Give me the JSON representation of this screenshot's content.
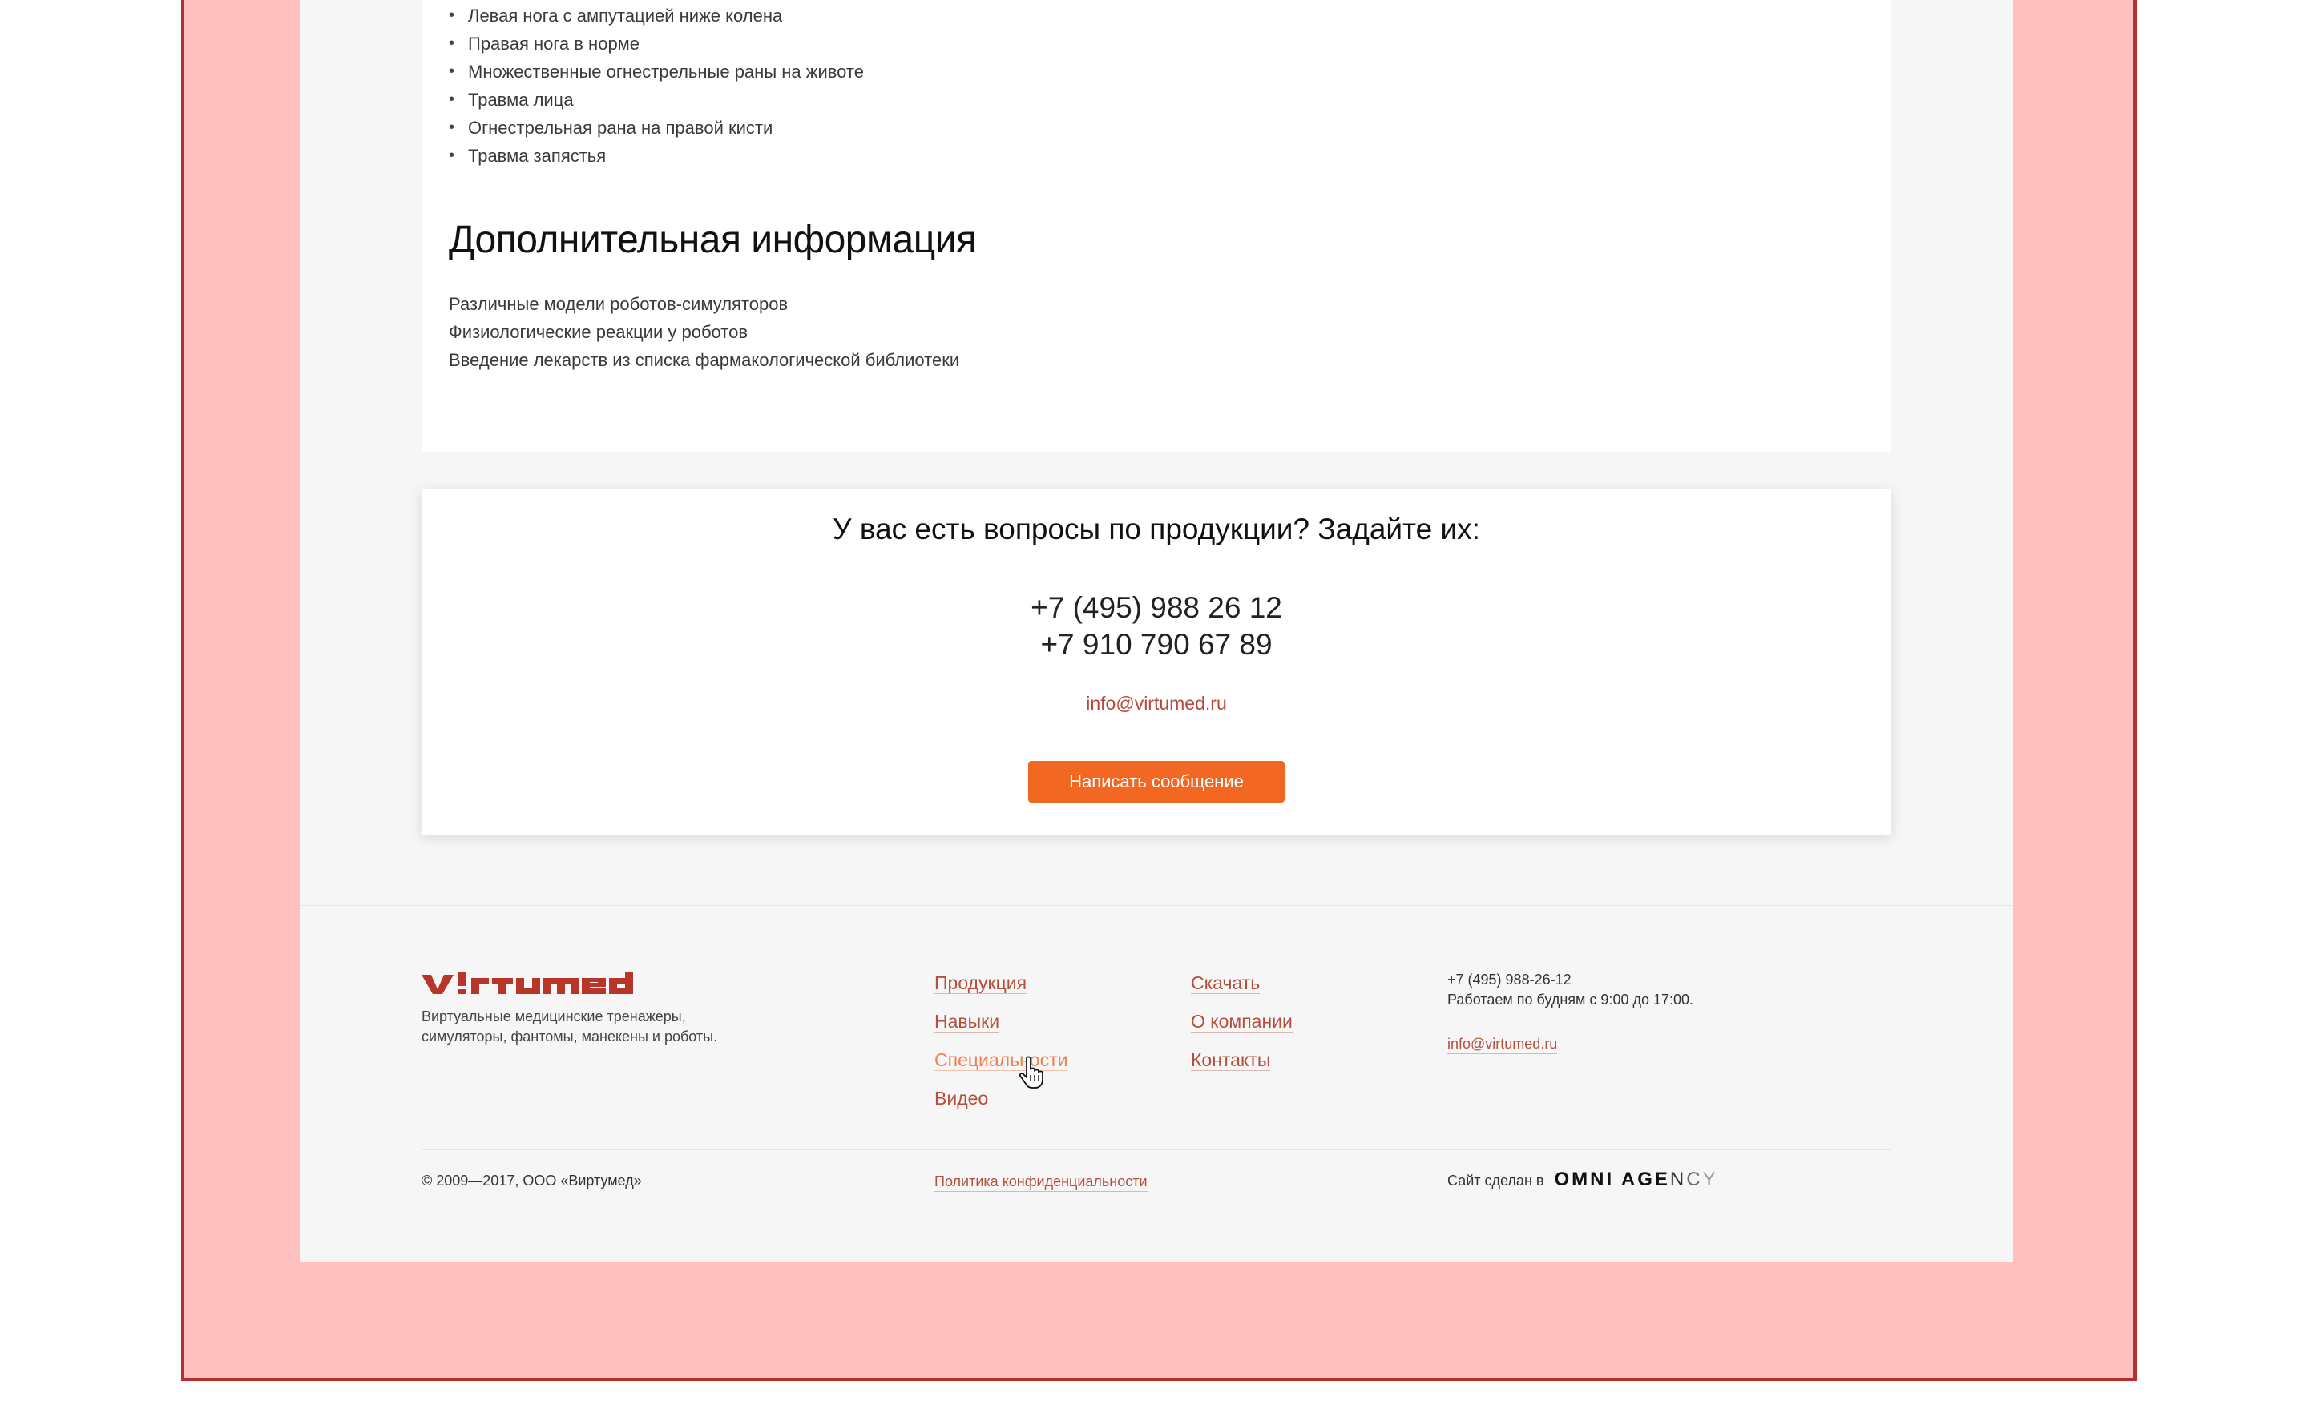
{
  "content": {
    "injury_items": [
      "Левая нога с ампутацией ниже колена",
      "Правая нога в норме",
      "Множественные огнестрельные раны на животе",
      "Травма лица",
      "Огнестрельная рана на правой кисти",
      "Травма запястья"
    ],
    "bullet": "•",
    "additional_heading": "Дополнительная информация",
    "additional_items": [
      "Различные модели роботов-симуляторов",
      "Физиологические реакции у роботов",
      "Введение лекарств из списка фармакологической библиотеки"
    ]
  },
  "questions": {
    "title": "У вас есть вопросы по продукции? Задайте их:",
    "phone_1": "+7 (495) 988 26 12",
    "phone_2": "+7 910 790 67 89",
    "email": "info@virtumed.ru",
    "button_label": "Написать сообщение"
  },
  "footer": {
    "tagline_line1": "Виртуальные медицинские тренажеры,",
    "tagline_line2": "симуляторы, фантомы, манекены и роботы.",
    "nav_col1": [
      "Продукция",
      "Навыки",
      "Специальности",
      "Видео"
    ],
    "nav_col2": [
      "Скачать",
      "О компании",
      "Контакты"
    ],
    "phone": "+7 (495) 988-26-12",
    "hours": "Работаем по будням с 9:00 до 17:00.",
    "email": "info@virtumed.ru",
    "copyright": "© 2009—2017, ООО «Виртумед»",
    "privacy": "Политика конфиденциальности",
    "made_by": "Сайт сделан в",
    "agency_bold": "OMNI AGE",
    "agency_n": "N",
    "agency_c": "C",
    "agency_y": "Y"
  },
  "colors": {
    "accent": "#f26722",
    "link": "#b4503c",
    "logo": "#b8352a",
    "frame_fill": "#ffc0c0",
    "frame_border": "#b72f2f"
  },
  "icons": {
    "logo": "virtumed-logo",
    "cursor": "hand-pointer-icon"
  }
}
